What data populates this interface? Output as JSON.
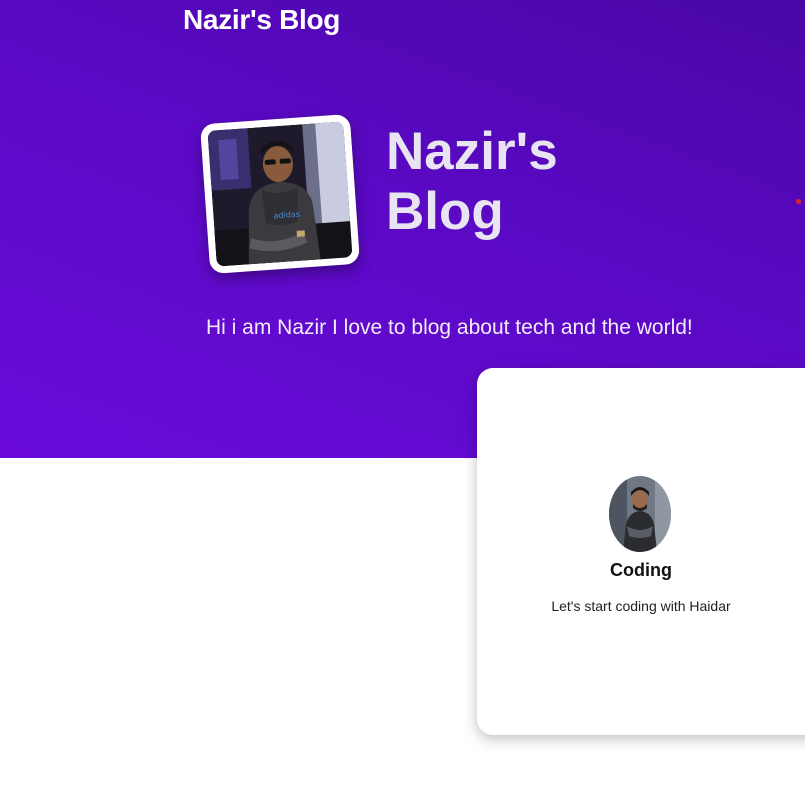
{
  "header": {
    "site_title": "Nazir's Blog"
  },
  "hero": {
    "title_line1": "Nazir's",
    "title_line2": "Blog",
    "subtitle": "Hi i am Nazir I love to blog about tech and the world!",
    "avatar_icon": "profile-photo-icon"
  },
  "post_card": {
    "title": "Coding",
    "description": "Let's start coding with Haidar",
    "image_icon": "post-thumbnail-icon"
  },
  "colors": {
    "hero_gradient_start": "#4a07a6",
    "hero_gradient_end": "#6a0bdb",
    "card_background": "#ffffff",
    "indicator_dot": "#d62828"
  }
}
